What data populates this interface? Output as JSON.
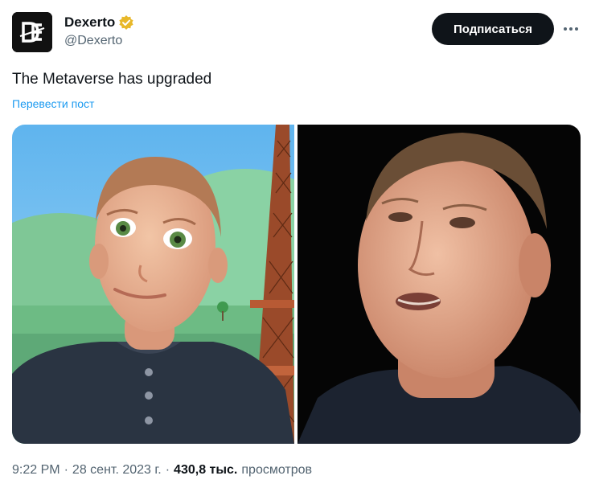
{
  "author": {
    "display_name": "Dexerto",
    "handle": "@Dexerto",
    "verified_badge_icon": "verified-badge-icon",
    "avatar_logo_text": "DE"
  },
  "follow_button": {
    "label": "Подписаться"
  },
  "more_button": {
    "icon": "more-horizontal-icon"
  },
  "tweet": {
    "text": "The Metaverse has upgraded",
    "translate_label": "Перевести пост"
  },
  "media": {
    "left_image": "metaverse-avatar-image",
    "right_image": "real-person-photo"
  },
  "meta": {
    "time": "9:22 PM",
    "separator": "·",
    "date": "28 сент. 2023 г.",
    "views_count": "430,8 тыс.",
    "views_label": "просмотров"
  },
  "colors": {
    "text_primary": "#0f1419",
    "text_secondary": "#536471",
    "link": "#1d9bf0",
    "badge_gold": "#e8b829",
    "button_bg": "#0f1419"
  }
}
